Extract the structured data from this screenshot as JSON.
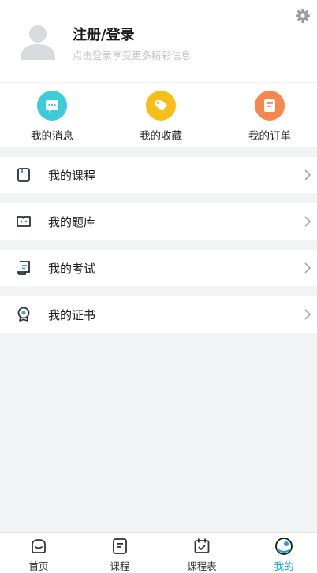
{
  "profile": {
    "name": "注册/登录",
    "subtitle": "点击登录享受更多精彩信息"
  },
  "quick_actions": [
    {
      "label": "我的消息",
      "icon": "message-icon",
      "color": "#3ccbd8"
    },
    {
      "label": "我的收藏",
      "icon": "favorite-tag-icon",
      "color": "#f7bd18"
    },
    {
      "label": "我的订单",
      "icon": "order-icon",
      "color": "#f5874c"
    }
  ],
  "menu": [
    {
      "label": "我的课程",
      "icon": "course-icon"
    },
    {
      "label": "我的题库",
      "icon": "question-bank-icon"
    },
    {
      "label": "我的考试",
      "icon": "exam-icon"
    },
    {
      "label": "我的证书",
      "icon": "certificate-icon"
    }
  ],
  "tabbar": [
    {
      "label": "首页",
      "icon": "home-icon",
      "active": false
    },
    {
      "label": "课程",
      "icon": "course-tab-icon",
      "active": false
    },
    {
      "label": "课程表",
      "icon": "schedule-icon",
      "active": false
    },
    {
      "label": "我的",
      "icon": "mine-icon",
      "active": true
    }
  ],
  "colors": {
    "accent": "#1aa0e6",
    "background": "#f2f3f5"
  }
}
